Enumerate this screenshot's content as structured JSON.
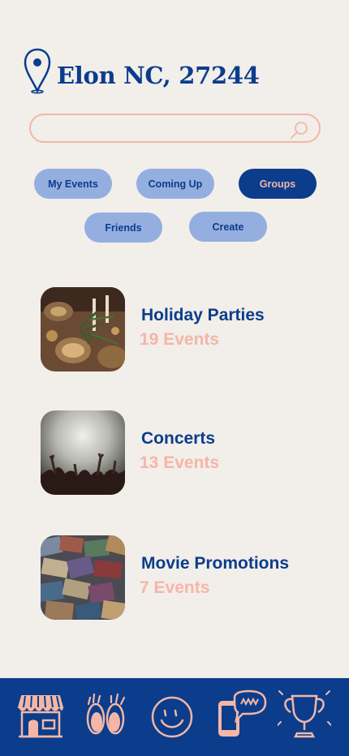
{
  "header": {
    "location": "Elon NC, 27244",
    "pin_icon": "location-pin-icon"
  },
  "search": {
    "value": "",
    "placeholder": "",
    "icon": "search-icon"
  },
  "filters": [
    {
      "label": "My Events",
      "active": false
    },
    {
      "label": "Coming Up",
      "active": false
    },
    {
      "label": "Groups",
      "active": true
    },
    {
      "label": "Friends",
      "active": false
    },
    {
      "label": "Create",
      "active": false
    }
  ],
  "groups": [
    {
      "title": "Holiday Parties",
      "count": "19 Events",
      "image": "holiday-party-photo"
    },
    {
      "title": "Concerts",
      "count": "13 Events",
      "image": "concert-crowd-photo"
    },
    {
      "title": "Movie Promotions",
      "count": "7 Events",
      "image": "movie-cassettes-photo"
    }
  ],
  "nav": [
    {
      "name": "store-icon"
    },
    {
      "name": "eyes-icon"
    },
    {
      "name": "smiley-face-icon"
    },
    {
      "name": "phone-chat-icon"
    },
    {
      "name": "trophy-icon"
    }
  ],
  "colors": {
    "primary": "#0b3d8c",
    "accent": "#f4b6a6",
    "chip": "#94aee0",
    "background": "#f2eeea"
  }
}
